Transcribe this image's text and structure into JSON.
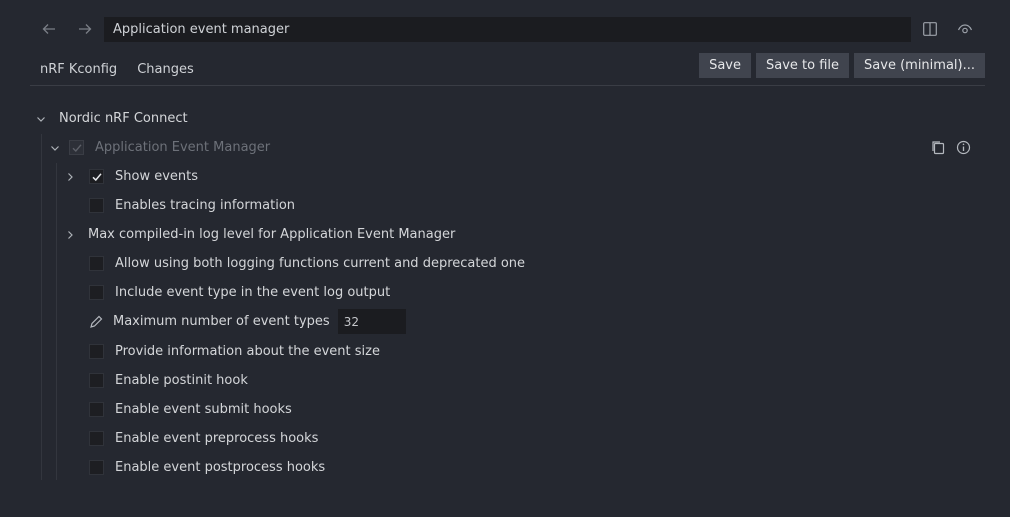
{
  "header": {
    "search_value": "Application event manager",
    "back_icon": "arrow-left-icon",
    "forward_icon": "arrow-right-icon",
    "split_icon": "split-view-icon",
    "eye_icon": "preview-eye-icon"
  },
  "tabs": [
    {
      "label": "nRF Kconfig",
      "active": true
    },
    {
      "label": "Changes",
      "active": false
    }
  ],
  "buttons": {
    "save": "Save",
    "save_to_file": "Save to file",
    "save_minimal": "Save (minimal)..."
  },
  "tree": {
    "root": {
      "label": "Nordic nRF Connect",
      "expanded": true
    },
    "manager": {
      "label": "Application Event Manager",
      "checked": true,
      "disabled": true,
      "expanded": true
    },
    "items": [
      {
        "label": "Show events",
        "checked": true,
        "expandable": true
      },
      {
        "label": "Enables tracing information",
        "checked": false
      },
      {
        "label": "Max compiled-in log level for Application Event Manager",
        "expandable": true,
        "menu": true
      },
      {
        "label": "Allow using both logging functions current and deprecated one",
        "checked": false
      },
      {
        "label": "Include event type in the event log output",
        "checked": false
      },
      {
        "label": "Maximum number of event types",
        "value": "32",
        "editable": true
      },
      {
        "label": "Provide information about the event size",
        "checked": false
      },
      {
        "label": "Enable postinit hook",
        "checked": false
      },
      {
        "label": "Enable event submit hooks",
        "checked": false
      },
      {
        "label": "Enable event preprocess hooks",
        "checked": false
      },
      {
        "label": "Enable event postprocess hooks",
        "checked": false
      }
    ]
  },
  "colors": {
    "background": "#252830",
    "input_bg": "#1b1c20",
    "button_bg": "#40444e",
    "text": "#d4d6d9"
  }
}
